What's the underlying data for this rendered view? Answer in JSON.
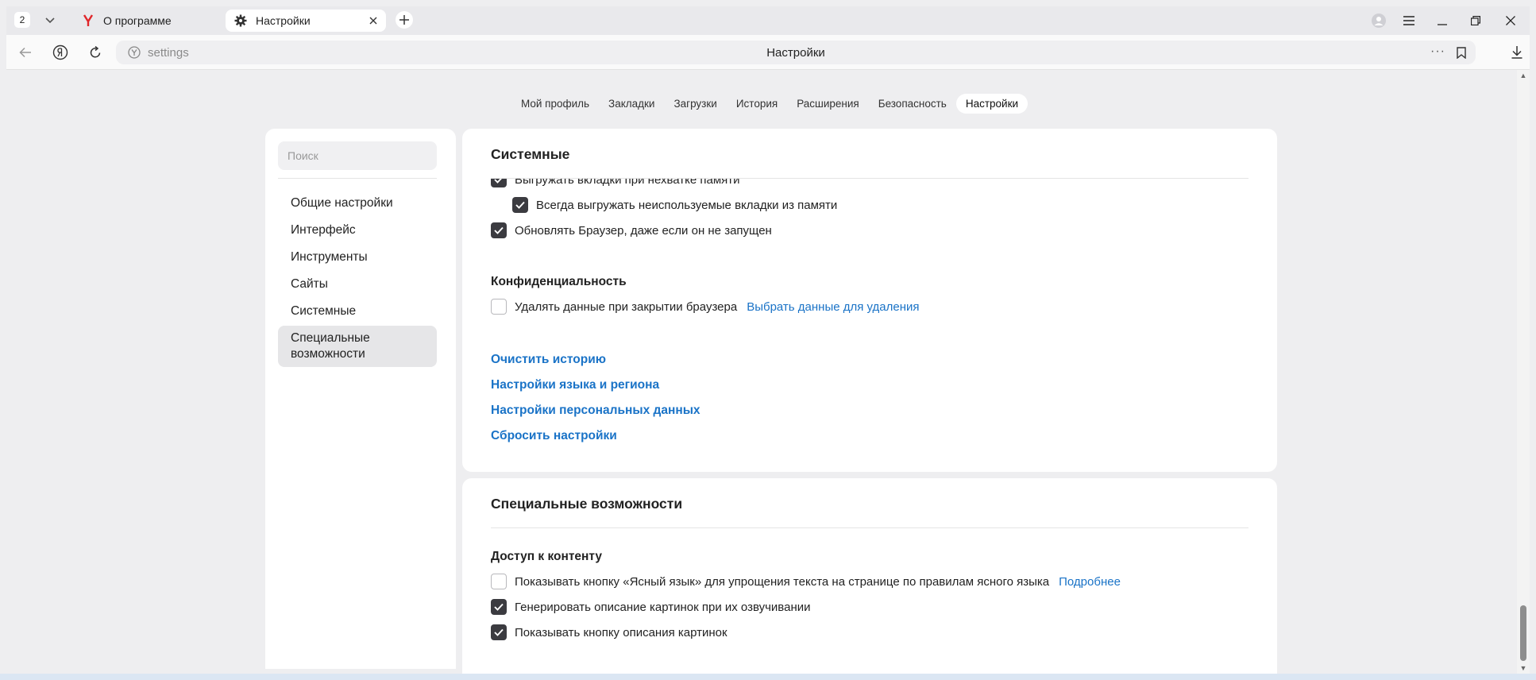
{
  "tabbar": {
    "tab_count": "2",
    "tabs": [
      {
        "title": "О программе",
        "icon": "yandex-logo-icon",
        "active": false
      },
      {
        "title": "Настройки",
        "icon": "gear-icon",
        "active": true
      }
    ]
  },
  "navbar": {
    "url": "settings",
    "page_title": "Настройки",
    "more": "···"
  },
  "top_nav": {
    "items": [
      "Мой профиль",
      "Закладки",
      "Загрузки",
      "История",
      "Расширения",
      "Безопасность",
      "Настройки"
    ],
    "active_index": 6
  },
  "sidebar": {
    "search_placeholder": "Поиск",
    "items": [
      {
        "label": "Общие настройки"
      },
      {
        "label": "Интерфейс"
      },
      {
        "label": "Инструменты"
      },
      {
        "label": "Сайты"
      },
      {
        "label": "Системные"
      },
      {
        "label": "Специальные возможности",
        "active": true
      }
    ]
  },
  "system": {
    "title": "Системные",
    "options": [
      {
        "label": "Выгружать вкладки при нехватке памяти",
        "checked": true
      },
      {
        "label": "Всегда выгружать неиспользуемые вкладки из памяти",
        "checked": true
      },
      {
        "label": "Обновлять Браузер, даже если он не запущен",
        "checked": true
      }
    ],
    "privacy": {
      "title": "Конфиденциальность",
      "option": {
        "label": "Удалять данные при закрытии браузера",
        "checked": false
      },
      "link": "Выбрать данные для удаления"
    },
    "links": [
      "Очистить историю",
      "Настройки языка и региона",
      "Настройки персональных данных",
      "Сбросить настройки"
    ]
  },
  "accessibility": {
    "title": "Специальные возможности",
    "content_access": {
      "title": "Доступ к контенту",
      "options": [
        {
          "label": "Показывать кнопку «Ясный язык» для упрощения текста на странице по правилам ясного языка",
          "checked": false,
          "link": "Подробнее"
        },
        {
          "label": "Генерировать описание картинок при их озвучивании",
          "checked": true
        },
        {
          "label": "Показывать кнопку описания картинок",
          "checked": true
        }
      ]
    }
  },
  "colors": {
    "accent_link": "#1a73c7",
    "checkbox_on": "#3b3b40",
    "background": "#eeeef0"
  }
}
